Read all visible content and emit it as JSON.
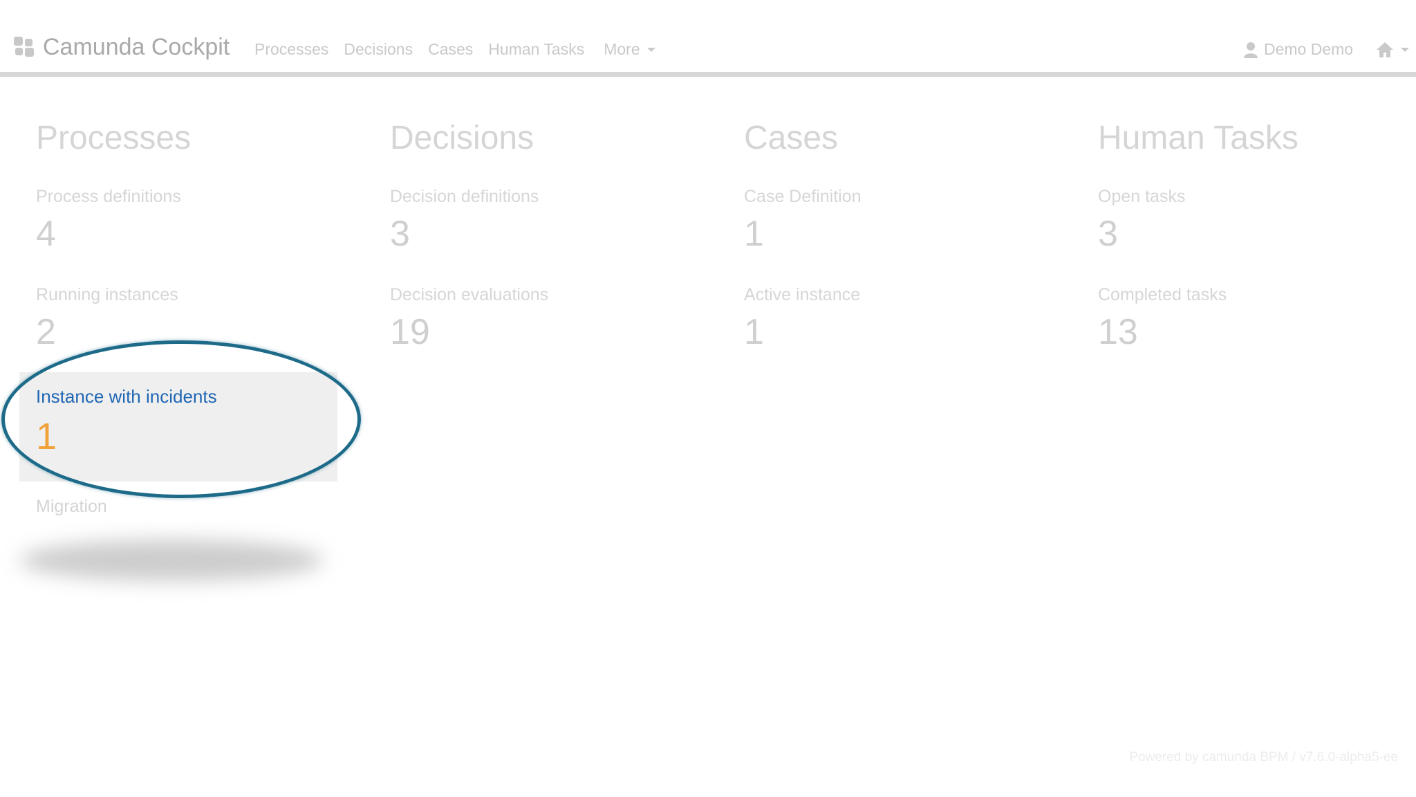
{
  "header": {
    "brand_title": "Camunda Cockpit",
    "nav": {
      "processes": "Processes",
      "decisions": "Decisions",
      "cases": "Cases",
      "human_tasks": "Human Tasks",
      "more": "More"
    },
    "user_name": "Demo Demo"
  },
  "cards": {
    "processes": {
      "title": "Processes",
      "definitions_label": "Process definitions",
      "definitions_value": "4",
      "running_label": "Running instances",
      "running_value": "2",
      "incidents_label": "Instance with incidents",
      "incidents_value": "1",
      "migration_label": "Migration"
    },
    "decisions": {
      "title": "Decisions",
      "definitions_label": "Decision definitions",
      "definitions_value": "3",
      "evaluations_label": "Decision evaluations",
      "evaluations_value": "19"
    },
    "cases": {
      "title": "Cases",
      "definition_label": "Case Definition",
      "definition_value": "1",
      "active_label": "Active instance",
      "active_value": "1"
    },
    "human_tasks": {
      "title": "Human Tasks",
      "open_label": "Open tasks",
      "open_value": "3",
      "completed_label": "Completed tasks",
      "completed_value": "13"
    }
  },
  "footer": {
    "text": "Powered by camunda BPM / v7.6.0-alpha5-ee"
  },
  "colors": {
    "link_blue": "#1f66b3",
    "incident_orange": "#f0a13a",
    "ring_teal": "#1e6b89"
  },
  "icons": {
    "brand": "camunda-logo-icon",
    "user": "user-icon",
    "home": "home-icon",
    "caret": "chevron-down-icon"
  }
}
